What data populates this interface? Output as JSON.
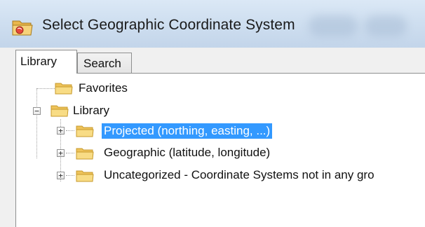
{
  "window": {
    "title": "Select Geographic Coordinate System",
    "icon": "globe-folder-icon"
  },
  "tabs": [
    {
      "label": "Library",
      "active": true
    },
    {
      "label": "Search",
      "active": false
    }
  ],
  "tree": {
    "items": [
      {
        "label": "Favorites",
        "level": 0,
        "expander": "none"
      },
      {
        "label": "Library",
        "level": 0,
        "expander": "minus"
      },
      {
        "label": "Projected (northing, easting, ...)",
        "level": 1,
        "expander": "plus",
        "selected": true
      },
      {
        "label": "Geographic (latitude, longitude)",
        "level": 1,
        "expander": "plus"
      },
      {
        "label": "Uncategorized - Coordinate Systems not in any gro",
        "level": 1,
        "expander": "plus"
      }
    ]
  },
  "colors": {
    "selection": "#3399ff",
    "folder": "#f5d36b",
    "titlebar": "#cfdff0"
  }
}
